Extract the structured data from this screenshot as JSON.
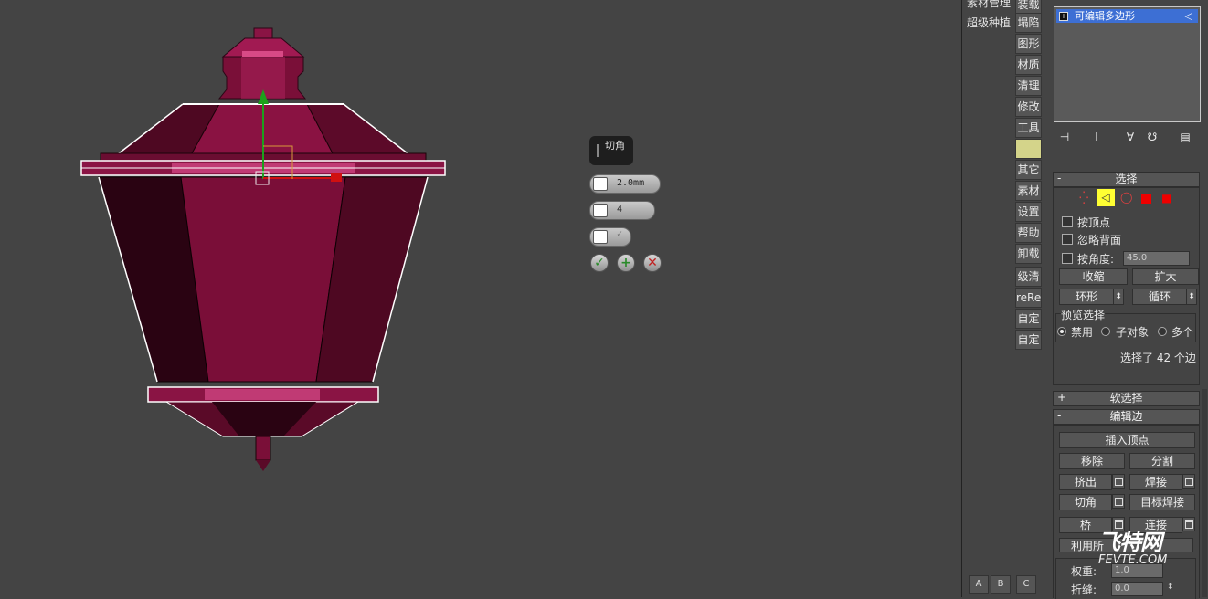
{
  "viewport": {
    "caddy": {
      "title": "切角",
      "amount_value": "2.0mm",
      "segments_value": "4",
      "confirm_icon": "checkmark-icon",
      "apply_icon": "plus-icon",
      "cancel_icon": "x-icon"
    }
  },
  "command_tabs": {
    "col1": [
      "素材管理",
      "超级种植"
    ],
    "col2": [
      "装载",
      "塌陷",
      "图形",
      "材质",
      "清理",
      "修改",
      "工具",
      "",
      "其它",
      "素材",
      "设置",
      "帮助",
      "卸载",
      "级清",
      "reRe",
      "自定",
      "自定"
    ],
    "bottom": [
      "A",
      "B",
      "C"
    ]
  },
  "modifier_stack": {
    "item": "可编辑多边形"
  },
  "select_rollout": {
    "title": "选择",
    "sign": "-",
    "by_vertex": "按顶点",
    "ignore_backfacing": "忽略背面",
    "by_angle": "按角度:",
    "angle_value": "45.0",
    "shrink": "收缩",
    "grow": "扩大",
    "ring": "环形",
    "loop": "循环",
    "preview_label": "预览选择",
    "preview_off": "禁用",
    "preview_sub": "子对象",
    "preview_multi": "多个",
    "status": "选择了 42 个边"
  },
  "soft_rollout": {
    "title": "软选择",
    "sign": "+"
  },
  "edit_edges_rollout": {
    "title": "编辑边",
    "sign": "-",
    "insert_vertex": "插入顶点",
    "remove": "移除",
    "split": "分割",
    "extrude": "挤出",
    "weld": "焊接",
    "chamfer": "切角",
    "target_weld": "目标焊接",
    "bridge": "桥",
    "connect": "连接",
    "use_selection": "利用所",
    "weight_label": "权重:",
    "weight_value": "1.0",
    "crease_label": "折缝:",
    "crease_value": "0.0"
  },
  "watermark": {
    "brand": "飞特网",
    "url": "FEVTE.COM"
  },
  "colors": {
    "viewport_bg": "#444444",
    "model_main": "#86103e",
    "selected_edge": "#ffffff",
    "active_tab": "#d4d48a",
    "selection_highlight": "#3d6fd4"
  }
}
